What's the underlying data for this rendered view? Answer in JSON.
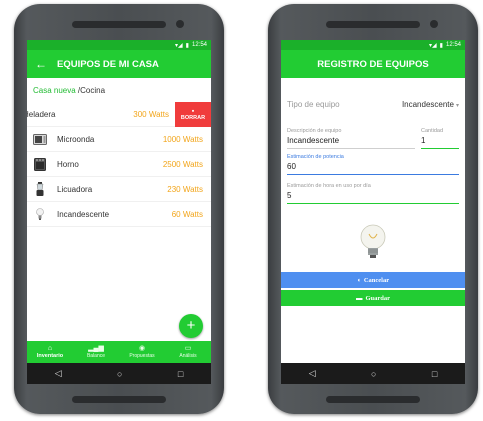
{
  "left_screen": {
    "status": {
      "signal": "▾◢",
      "battery": "▮",
      "time": "12:54"
    },
    "appbar": {
      "back": "←",
      "title": "EQUIPOS DE MI CASA"
    },
    "breadcrumb": {
      "link": "Casa nueva",
      "separator": " /",
      "current": "Cocina"
    },
    "items": [
      {
        "name": "Heladera",
        "watts": "300 Watts",
        "icon": "fridge-icon",
        "swiped": true
      },
      {
        "name": "Microonda",
        "watts": "1000 Watts",
        "icon": "microwave-icon"
      },
      {
        "name": "Horno",
        "watts": "2500 Watts",
        "icon": "oven-icon"
      },
      {
        "name": "Licuadora",
        "watts": "230 Watts",
        "icon": "blender-icon"
      },
      {
        "name": "Incandescente",
        "watts": "60 Watts",
        "icon": "bulb-icon"
      }
    ],
    "delete_label": "BORRAR",
    "fab": "+",
    "bottom_nav": [
      {
        "label": "Inventario",
        "icon": "home-icon",
        "active": true
      },
      {
        "label": "Balance",
        "icon": "bars-icon"
      },
      {
        "label": "Propuestas",
        "icon": "coins-icon"
      },
      {
        "label": "Análisis",
        "icon": "calendar-icon"
      }
    ]
  },
  "right_screen": {
    "status": {
      "signal": "▾◢",
      "battery": "▮",
      "time": "12:54"
    },
    "appbar": {
      "title": "REGISTRO DE EQUIPOS"
    },
    "type": {
      "label": "Tipo de equipo",
      "value": "Incandescente"
    },
    "description": {
      "label": "Descripción de equipo",
      "value": "Incandescente"
    },
    "quantity": {
      "label": "Cantidad",
      "value": "1"
    },
    "power": {
      "label": "Estimación de potencia",
      "value": "60"
    },
    "hours": {
      "label": "Estimación de hora en uso por día",
      "value": "5"
    },
    "cancel_label": "Cancelar",
    "save_label": "Guardar"
  },
  "system_nav": {
    "back": "◁",
    "home": "○",
    "recent": "□"
  },
  "colors": {
    "primary": "#22cc33",
    "danger": "#f03c3c",
    "accent": "#f2a51a",
    "cancel": "#4f8ff0"
  }
}
